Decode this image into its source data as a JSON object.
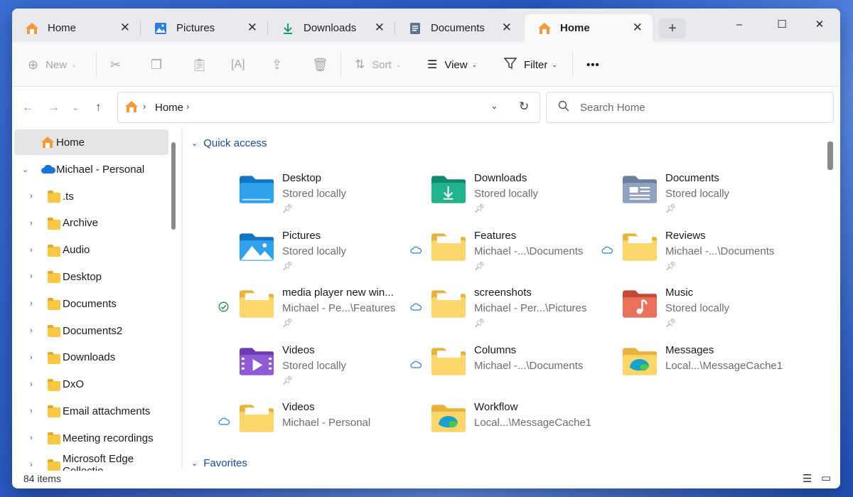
{
  "tabs": [
    {
      "label": "Home",
      "icon": "home-icon"
    },
    {
      "label": "Pictures",
      "icon": "pictures-icon"
    },
    {
      "label": "Downloads",
      "icon": "downloads-icon"
    },
    {
      "label": "Documents",
      "icon": "documents-icon"
    },
    {
      "label": "Home",
      "icon": "home-icon",
      "active": true
    }
  ],
  "window_controls": {
    "minimize": "–",
    "maximize": "☐",
    "close": "✕"
  },
  "toolbar": {
    "new_label": "New",
    "sort_label": "Sort",
    "view_label": "View",
    "filter_label": "Filter",
    "more_label": "•••"
  },
  "address": {
    "crumb": "Home",
    "search_placeholder": "Search Home"
  },
  "sidebar": {
    "home": "Home",
    "account": "Michael - Personal",
    "folders": [
      ".ts",
      "Archive",
      "Audio",
      "Desktop",
      "Documents",
      "Documents2",
      "Downloads",
      "DxO",
      "Email attachments",
      "Meeting recordings",
      "Microsoft Edge Collectio"
    ]
  },
  "main": {
    "quick_access": "Quick access",
    "favorites": "Favorites",
    "items": [
      {
        "name": "Desktop",
        "sub": "Stored locally",
        "pinned": true,
        "status": "",
        "icon": "desktop-folder-icon"
      },
      {
        "name": "Downloads",
        "sub": "Stored locally",
        "pinned": true,
        "status": "",
        "icon": "downloads-folder-icon"
      },
      {
        "name": "Documents",
        "sub": "Stored locally",
        "pinned": true,
        "status": "",
        "icon": "documents-folder-icon"
      },
      {
        "name": "Pictures",
        "sub": "Stored locally",
        "pinned": true,
        "status": "",
        "icon": "pictures-folder-icon"
      },
      {
        "name": "Features",
        "sub": "Michael -...\\Documents",
        "pinned": true,
        "status": "cloud",
        "icon": "folder-icon"
      },
      {
        "name": "Reviews",
        "sub": "Michael -...\\Documents",
        "pinned": true,
        "status": "cloud",
        "icon": "folder-icon"
      },
      {
        "name": "media player new win...",
        "sub": "Michael - Pe...\\Features",
        "pinned": true,
        "status": "synced",
        "icon": "folder-icon"
      },
      {
        "name": "screenshots",
        "sub": "Michael - Per...\\Pictures",
        "pinned": true,
        "status": "cloud",
        "icon": "folder-icon"
      },
      {
        "name": "Music",
        "sub": "Stored locally",
        "pinned": true,
        "status": "",
        "icon": "music-folder-icon"
      },
      {
        "name": "Videos",
        "sub": "Stored locally",
        "pinned": true,
        "status": "",
        "icon": "videos-folder-icon"
      },
      {
        "name": "Columns",
        "sub": "Michael -...\\Documents",
        "pinned": false,
        "status": "cloud",
        "icon": "folder-icon"
      },
      {
        "name": "Messages",
        "sub": "Local...\\MessageCache1",
        "pinned": false,
        "status": "",
        "icon": "edge-folder-icon"
      },
      {
        "name": "Videos",
        "sub": "Michael - Personal",
        "pinned": false,
        "status": "cloud",
        "icon": "folder-icon"
      },
      {
        "name": "Workflow",
        "sub": "Local...\\MessageCache1",
        "pinned": false,
        "status": "",
        "icon": "edge-folder-icon"
      }
    ]
  },
  "status": {
    "count": "84 items"
  },
  "colors": {
    "accent": "#1a4b9c",
    "folder": "#f8c843"
  }
}
